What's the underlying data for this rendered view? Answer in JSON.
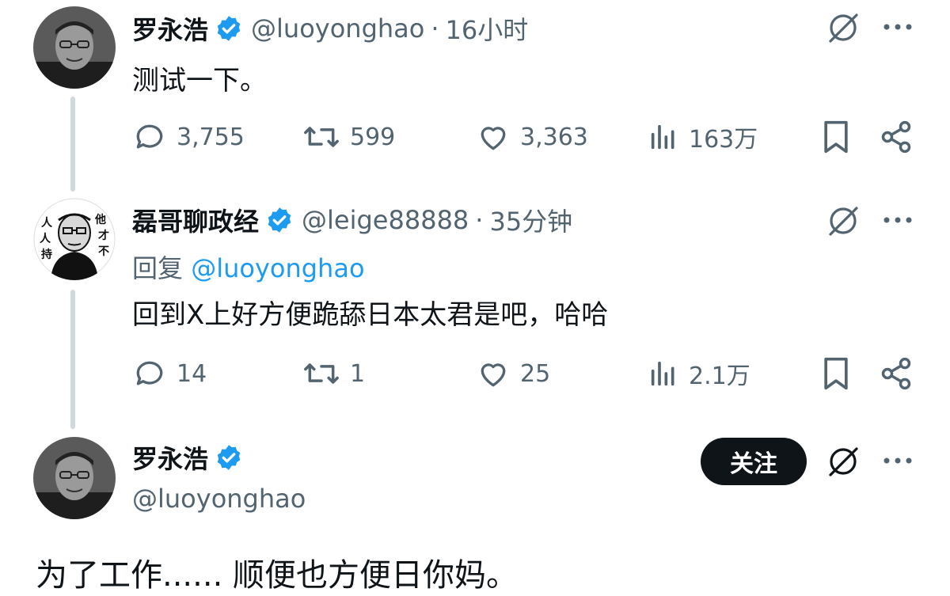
{
  "tweets": [
    {
      "name": "罗永浩",
      "handle": "@luoyonghao",
      "separator": "·",
      "time": "16小时",
      "text": "测试一下。",
      "stats": {
        "reply": "3,755",
        "retweet": "599",
        "like": "3,363",
        "views": "163万"
      }
    },
    {
      "name": "磊哥聊政经",
      "handle": "@leige88888",
      "separator": "·",
      "time": "35分钟",
      "reply_prefix": "回复",
      "reply_mention": "@luoyonghao",
      "text": "回到X上好方便跪舔日本太君是吧，哈哈",
      "stats": {
        "reply": "14",
        "retweet": "1",
        "like": "25",
        "views": "2.1万"
      }
    }
  ],
  "main": {
    "name": "罗永浩",
    "handle": "@luoyonghao",
    "follow_label": "关注",
    "text": "为了工作...... 顺便也方便日你妈。"
  },
  "avatar_badge_text": "他才不 人人 持",
  "colors": {
    "verified": "#1d9bf0",
    "mention": "#1d9bf0",
    "muted": "#536471",
    "text": "#0f1419",
    "thread_line": "#cfd9de"
  },
  "icons": [
    "verified-badge-icon",
    "grok-icon",
    "more-icon",
    "reply-icon",
    "retweet-icon",
    "like-icon",
    "views-icon",
    "bookmark-icon",
    "share-icon"
  ]
}
